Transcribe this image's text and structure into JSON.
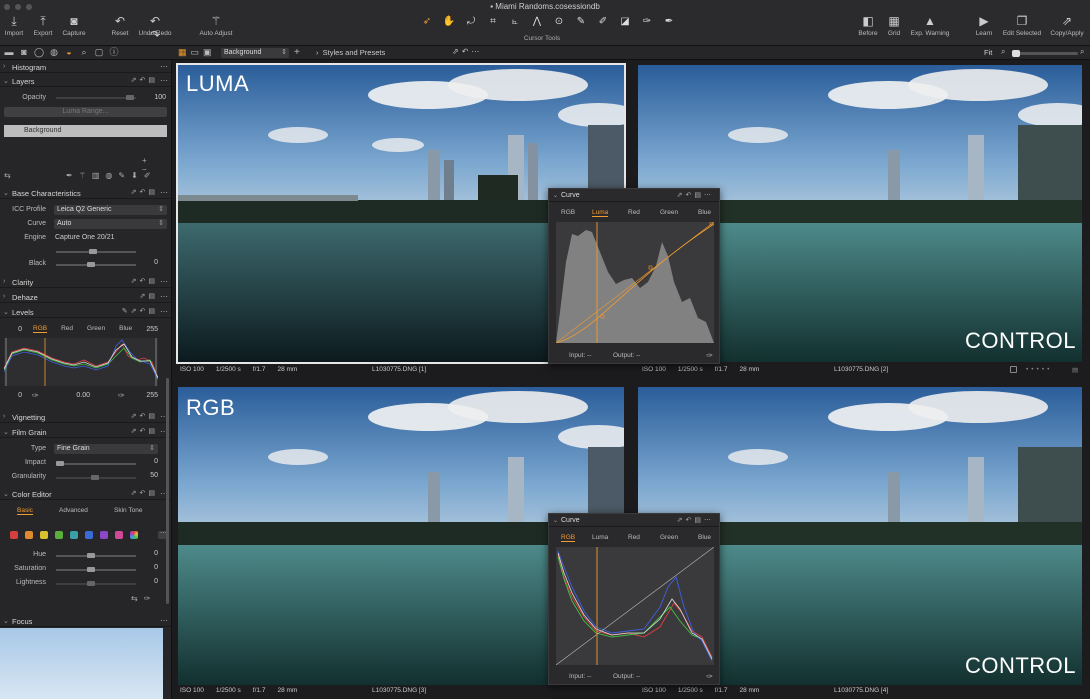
{
  "window": {
    "title": "Miami Randoms.cosessiondb"
  },
  "toolbar": {
    "import": "Import",
    "export": "Export",
    "capture": "Capture",
    "reset": "Reset",
    "undo_redo": "Undo/Redo",
    "auto_adjust": "Auto Adjust",
    "cursor_tools": "Cursor Tools",
    "before": "Before",
    "grid": "Grid",
    "exp_warning": "Exp. Warning",
    "learn": "Learn",
    "edit_selected": "Edit Selected",
    "copy_apply": "Copy/Apply"
  },
  "secondbar": {
    "variant_select": "Background",
    "styles": "Styles and Presets",
    "fit": "Fit"
  },
  "panel": {
    "histogram": "Histogram",
    "layers": {
      "title": "Layers",
      "opacity_label": "Opacity",
      "opacity_value": "100",
      "luma_range": "Luma Range...",
      "background_layer": "Background"
    },
    "base": {
      "title": "Base Characteristics",
      "icc_label": "ICC Profile",
      "icc_value": "Leica Q2 Generic",
      "curve_label": "Curve",
      "curve_value": "Auto",
      "engine_label": "Engine",
      "engine_value": "Capture One 20/21"
    },
    "black": {
      "label": "Black",
      "value": "0"
    },
    "clarity": "Clarity",
    "dehaze": "Dehaze",
    "levels": {
      "title": "Levels",
      "low": "0",
      "high": "255",
      "tabs": [
        "RGB",
        "Red",
        "Green",
        "Blue"
      ],
      "out_low": "0",
      "mid": "0.00",
      "out_high": "255"
    },
    "vignetting": "Vignetting",
    "film_grain": {
      "title": "Film Grain",
      "type_label": "Type",
      "type_value": "Fine Grain",
      "impact_label": "Impact",
      "impact_value": "0",
      "granularity_label": "Granularity",
      "granularity_value": "50"
    },
    "color_editor": {
      "title": "Color Editor",
      "tabs": [
        "Basic",
        "Advanced",
        "Skin Tone"
      ],
      "hue_label": "Hue",
      "hue_value": "0",
      "saturation_label": "Saturation",
      "saturation_value": "0",
      "lightness_label": "Lightness",
      "lightness_value": "0"
    },
    "focus": "Focus"
  },
  "swatches": [
    "#d24040",
    "#e08a30",
    "#d8c030",
    "#5aae3c",
    "#3aa0a8",
    "#3a6ad8",
    "#8a48c8",
    "#d04898"
  ],
  "viewer": {
    "images": [
      {
        "label": "LUMA",
        "iso": "ISO 100",
        "shutter": "1/2500 s",
        "aperture": "f/1.7",
        "focal": "28 mm",
        "file": "L1030775.DNG [1]"
      },
      {
        "label": "CONTROL",
        "iso": "ISO 100",
        "shutter": "1/2500 s",
        "aperture": "f/1.7",
        "focal": "28 mm",
        "file": "L1030775.DNG [2]"
      },
      {
        "label": "RGB",
        "iso": "ISO 100",
        "shutter": "1/2500 s",
        "aperture": "f/1.7",
        "focal": "28 mm",
        "file": "L1030775.DNG [3]"
      },
      {
        "label": "CONTROL",
        "iso": "ISO 100",
        "shutter": "1/2500 s",
        "aperture": "f/1.7",
        "focal": "28 mm",
        "file": "L1030775.DNG [4]"
      }
    ],
    "curve_windows": [
      {
        "title": "Curve",
        "tabs": [
          "RGB",
          "Luma",
          "Red",
          "Green",
          "Blue"
        ],
        "active": "Luma",
        "input": "Input:",
        "input_val": "--",
        "output": "Output:",
        "output_val": "--"
      },
      {
        "title": "Curve",
        "tabs": [
          "RGB",
          "Luma",
          "Red",
          "Green",
          "Blue"
        ],
        "active": "RGB",
        "input": "Input:",
        "input_val": "--",
        "output": "Output:",
        "output_val": "--"
      }
    ]
  },
  "colors": {
    "accent": "#f29b2f",
    "panel_bg": "#262628",
    "toolbar_bg": "#2b2b2d"
  }
}
